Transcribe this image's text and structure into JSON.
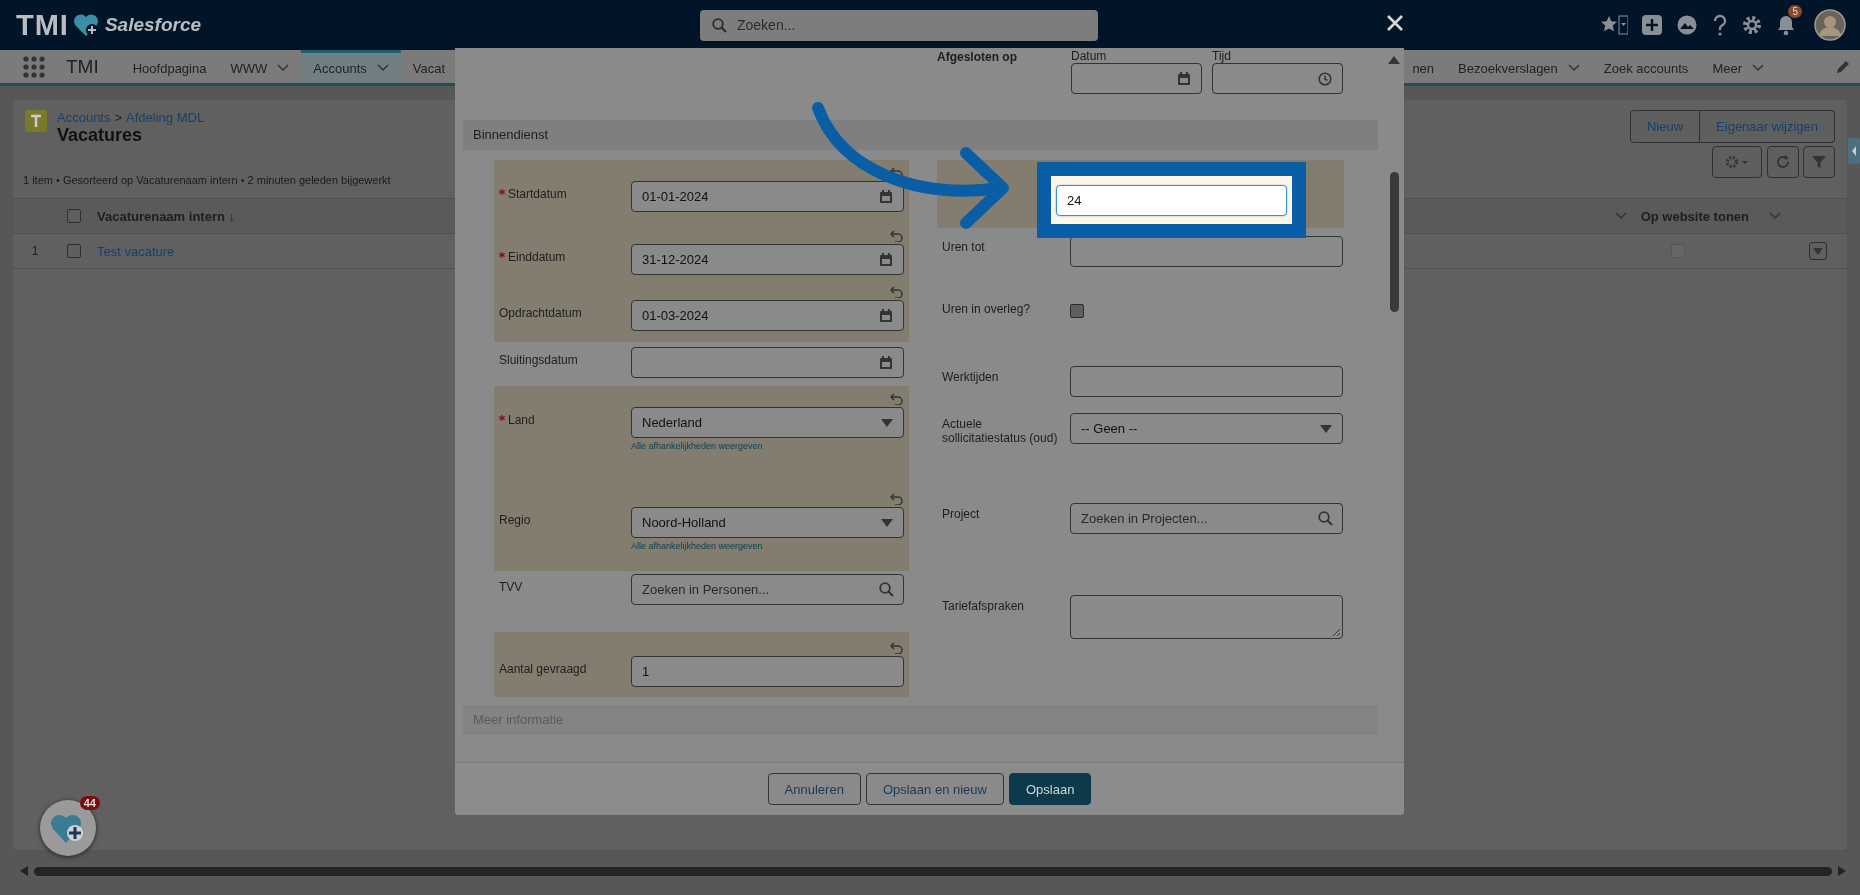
{
  "header": {
    "logo_text": "TMI",
    "brand": "Salesforce",
    "search": {
      "placeholder": "Zoeken..."
    },
    "notification_count": "5"
  },
  "nav": {
    "app_name": "TMI",
    "items_left": [
      {
        "label": "Hoofdpagina",
        "selected": false,
        "menu": false
      },
      {
        "label": "WWW",
        "selected": false,
        "menu": true
      },
      {
        "label": "Accounts",
        "selected": true,
        "menu": true
      },
      {
        "label": "Vacat",
        "selected": false,
        "menu": false
      }
    ],
    "items_right": [
      {
        "label": "nen",
        "selected": false,
        "menu": false
      },
      {
        "label": "Bezoekverslagen",
        "selected": false,
        "menu": true
      },
      {
        "label": "Zoek accounts",
        "selected": false,
        "menu": false
      },
      {
        "label": "Meer",
        "selected": false,
        "menu": true
      }
    ]
  },
  "list_view": {
    "breadcrumb": [
      {
        "label": "Accounts"
      },
      {
        "label": "Afdeling MDL"
      }
    ],
    "breadcrumb_sep": ">",
    "title": "Vacatures",
    "info": "1 item • Gesorteerd op Vacaturenaam intern • 2 minuten geleden bijgewerkt",
    "buttons": [
      "Nieuw",
      "Eigenaar wijzigen"
    ],
    "columns": [
      {
        "label": "Vacaturenaam intern ↓"
      },
      {
        "label": "Op website tonen"
      }
    ],
    "all_selected": false,
    "rows": [
      {
        "number": "1",
        "name": "Test vacature",
        "checked": false,
        "website": false
      }
    ]
  },
  "modal": {
    "closed_on": {
      "label": "Afgesloten op",
      "date_label": "Datum",
      "time_label": "Tijd"
    },
    "section": "Binnendienst",
    "left_fields": [
      {
        "label": "Startdatum",
        "kind": "date",
        "value": "01-01-2024",
        "required": true,
        "changed": true
      },
      {
        "label": "Einddatum",
        "kind": "date",
        "value": "31-12-2024",
        "required": true,
        "changed": true
      },
      {
        "label": "Opdrachtdatum",
        "kind": "date",
        "value": "01-03-2024",
        "required": false,
        "changed": true
      },
      {
        "label": "Sluitingsdatum",
        "kind": "date",
        "required": false,
        "changed": false
      },
      {
        "label": "Land",
        "kind": "picklist",
        "value": "Nederland",
        "required": true,
        "changed": true,
        "link": "Alle afhankelijkheden weergeven"
      },
      {
        "label": "Regio",
        "kind": "picklist",
        "value": "Noord-Holland",
        "required": false,
        "changed": true,
        "link": "Alle afhankelijkheden weergeven"
      },
      {
        "label": "TVV",
        "kind": "lookup",
        "placeholder": "Zoeken in Personen...",
        "required": false,
        "changed": false
      },
      {
        "label": "Aantal gevraagd",
        "kind": "text",
        "value": "1",
        "required": false,
        "changed": true
      }
    ],
    "right_fields": [
      {
        "kind": "text",
        "value": "24",
        "changed": true,
        "focused": true
      },
      {
        "label": "Uren tot",
        "kind": "text",
        "changed": false,
        "focused": false
      },
      {
        "label": "Uren in overleg?",
        "kind": "checkbox",
        "checked": false,
        "changed": false,
        "focused": false
      },
      {
        "label": "Werktijden",
        "kind": "text",
        "changed": false,
        "focused": false
      },
      {
        "label": "Actuele sollicitatiestatus (oud)",
        "kind": "picklist",
        "value": "-- Geen --",
        "changed": false,
        "focused": false
      },
      {
        "label": "Project",
        "kind": "lookup",
        "placeholder": "Zoeken in Projecten...",
        "changed": false,
        "focused": false
      },
      {
        "label": "Tariefafspraken",
        "kind": "textarea",
        "changed": false,
        "focused": false
      }
    ],
    "next_section": "Meer informatie",
    "buttons": [
      {
        "label": "Annuleren",
        "kind": "neutral"
      },
      {
        "label": "Opslaan en nieuw",
        "kind": "neutral"
      },
      {
        "label": "Opslaan",
        "kind": "brand"
      }
    ]
  },
  "utility": {
    "badge": "44"
  }
}
